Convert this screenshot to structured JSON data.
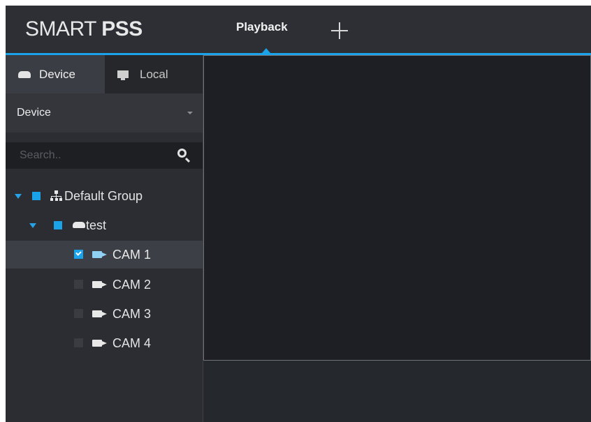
{
  "app": {
    "logo_light": "SMART ",
    "logo_bold": "PSS"
  },
  "tabs": {
    "active": "Playback",
    "add_icon": "plus-icon"
  },
  "colors": {
    "accent": "#1aa3e8",
    "background": "#2a2c31",
    "video_bg": "#1d1f24"
  },
  "left_panel": {
    "tabs": [
      {
        "label": "Device",
        "icon": "device-icon",
        "active": true
      },
      {
        "label": "Local",
        "icon": "monitor-icon",
        "active": false
      }
    ],
    "dropdown": {
      "selected": "Device"
    },
    "search": {
      "placeholder": "Search..",
      "value": ""
    },
    "tree": {
      "group": {
        "label": "Default Group",
        "expanded": true
      },
      "device": {
        "label": "test",
        "expanded": true
      },
      "channels": [
        {
          "label": "CAM 1",
          "checked": true,
          "selected": true
        },
        {
          "label": "CAM 2",
          "checked": false,
          "selected": false
        },
        {
          "label": "CAM 3",
          "checked": false,
          "selected": false
        },
        {
          "label": "CAM 4",
          "checked": false,
          "selected": false
        }
      ]
    }
  }
}
